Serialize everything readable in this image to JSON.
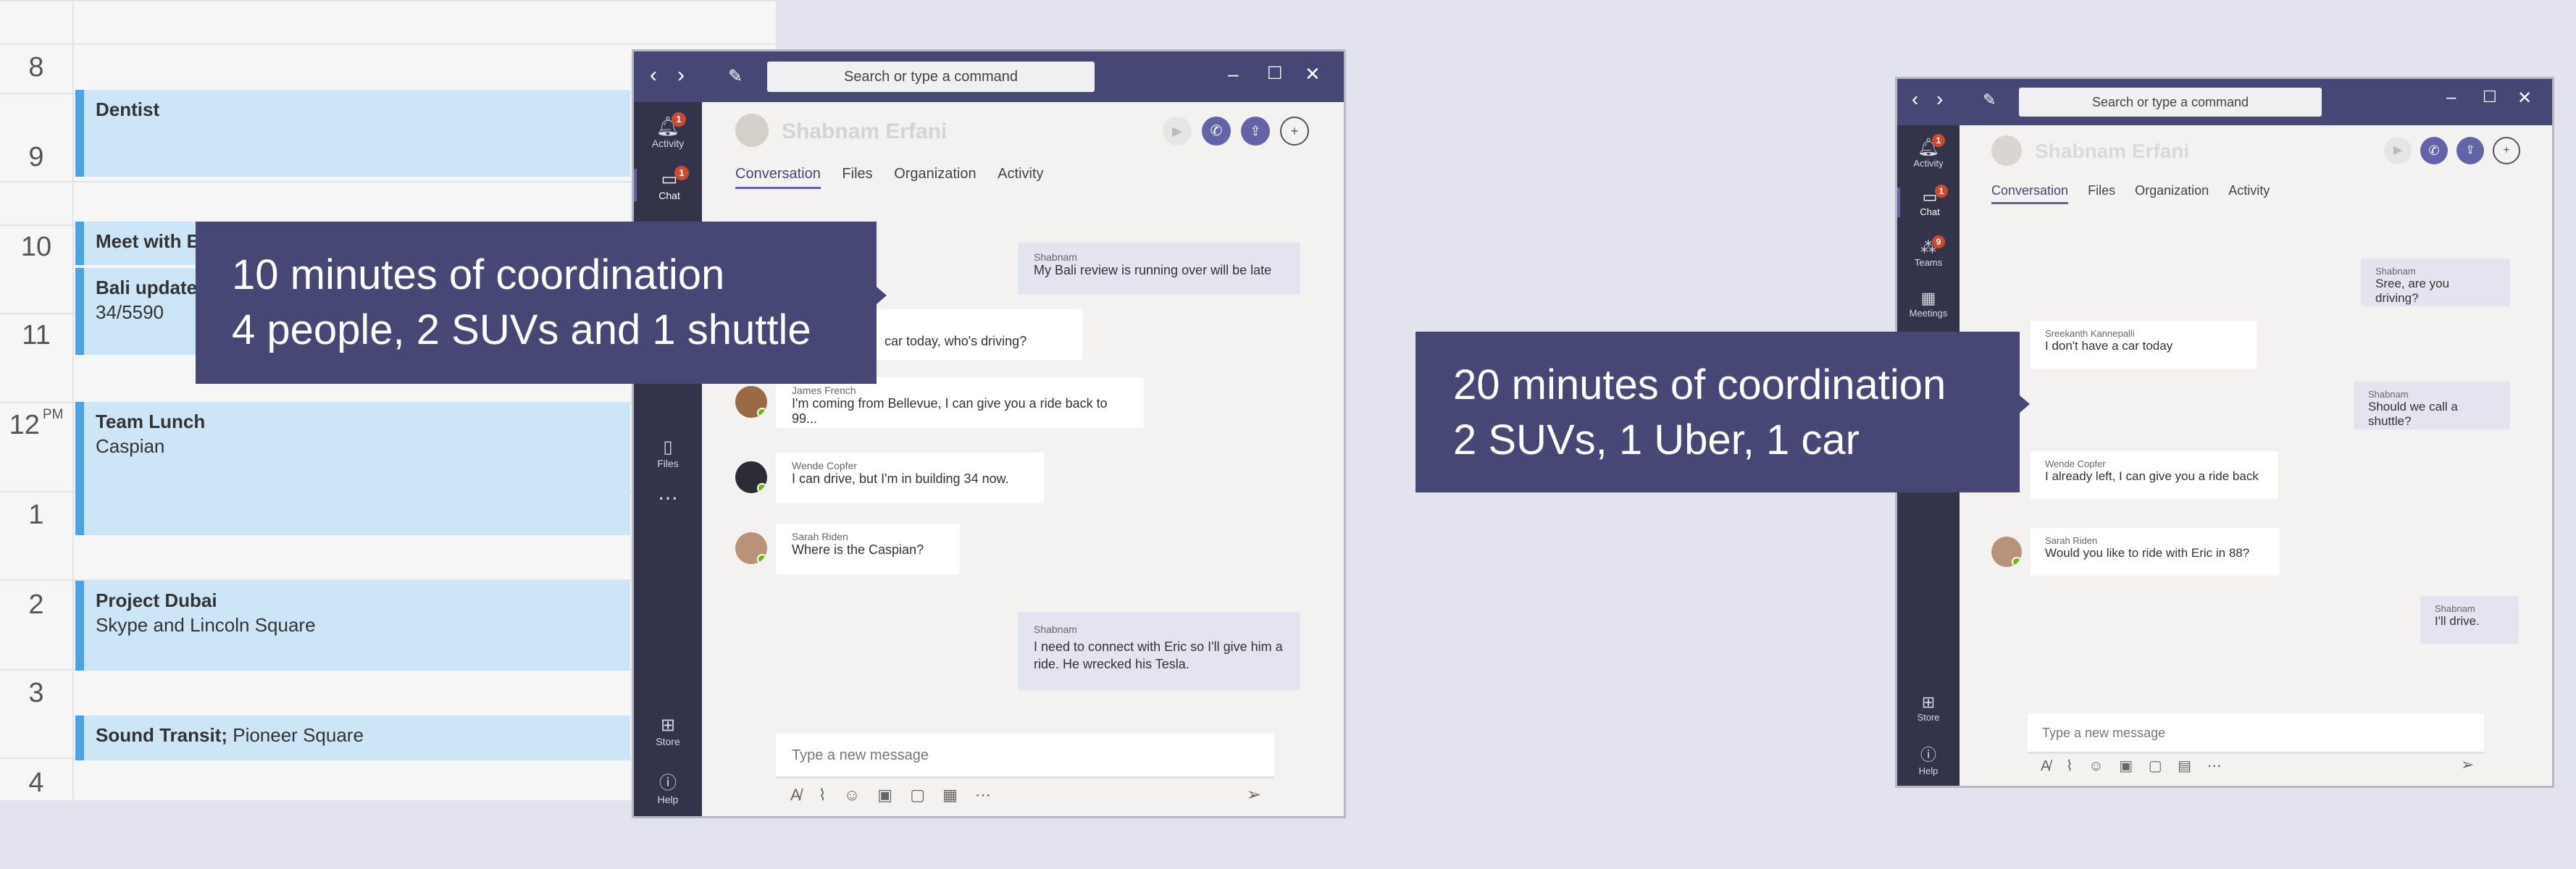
{
  "calendar": {
    "hours": [
      {
        "label": "8",
        "pm": ""
      },
      {
        "label": "9",
        "pm": ""
      },
      {
        "label": "10",
        "pm": ""
      },
      {
        "label": "11",
        "pm": ""
      },
      {
        "label": "12",
        "pm": "PM"
      },
      {
        "label": "1",
        "pm": ""
      },
      {
        "label": "2",
        "pm": ""
      },
      {
        "label": "3",
        "pm": ""
      },
      {
        "label": "4",
        "pm": ""
      }
    ],
    "events": [
      {
        "title": "Dentist",
        "detail": ""
      },
      {
        "title": "Meet with Er",
        "detail": ""
      },
      {
        "title": "Bali update",
        "detail": "34/5590"
      },
      {
        "title": "Team Lunch",
        "detail": "Caspian"
      },
      {
        "title": "Project Dubai",
        "detail": "Skype and Lincoln Square"
      },
      {
        "title": "Sound Transit;",
        "detail": " Pioneer Square"
      }
    ]
  },
  "window1": {
    "search_placeholder": "Search or type a command",
    "contact": "Shabnam Erfani",
    "tabs": [
      "Conversation",
      "Files",
      "Organization",
      "Activity"
    ],
    "rail": [
      {
        "label": "Activity",
        "badge": "1"
      },
      {
        "label": "Chat",
        "badge": "1"
      },
      {
        "label": "Files",
        "badge": ""
      },
      {
        "label": "Store",
        "badge": ""
      },
      {
        "label": "Help",
        "badge": ""
      }
    ],
    "messages": [
      {
        "sender": "Shabnam",
        "text": "My Bali review is running over will be late"
      },
      {
        "sender": "",
        "text": "car today, who's driving?"
      },
      {
        "sender": "James French",
        "text": "I'm coming from Bellevue, I can give you a ride back to 99..."
      },
      {
        "sender": "Wende Copfer",
        "text": "I can drive, but I'm in building 34 now."
      },
      {
        "sender": "Sarah Riden",
        "text": "Where is the Caspian?"
      },
      {
        "sender": "Shabnam",
        "text": "I need to connect with Eric so I'll give him a ride. He wrecked his Tesla."
      }
    ],
    "compose_placeholder": "Type a new message"
  },
  "window2": {
    "search_placeholder": "Search or type a command",
    "contact": "Shabnam Erfani",
    "tabs": [
      "Conversation",
      "Files",
      "Organization",
      "Activity"
    ],
    "rail": [
      {
        "label": "Activity",
        "badge": "1"
      },
      {
        "label": "Chat",
        "badge": "1"
      },
      {
        "label": "Teams",
        "badge": "9"
      },
      {
        "label": "Meetings",
        "badge": ""
      },
      {
        "label": "Store",
        "badge": ""
      },
      {
        "label": "Help",
        "badge": ""
      }
    ],
    "messages": [
      {
        "sender": "Shabnam",
        "text": "Sree, are you driving?"
      },
      {
        "sender": "Sreekanth Kannepalli",
        "text": "I don't have a car today"
      },
      {
        "sender": "Shabnam",
        "text": "Should we call a shuttle?"
      },
      {
        "sender": "Wende Copfer",
        "text": "I already left, I can give you a ride back"
      },
      {
        "sender": "Sarah Riden",
        "text": "Would you like to ride with Eric in 88?"
      },
      {
        "sender": "Shabnam",
        "text": "I'll drive."
      }
    ],
    "compose_placeholder": "Type a new message"
  },
  "callout1": {
    "line1": "10 minutes of coordination",
    "line2": "4 people, 2 SUVs and 1 shuttle"
  },
  "callout2": {
    "line1": "20 minutes of coordination",
    "line2": "2 SUVs, 1 Uber, 1 car"
  },
  "colors": {
    "teams_purple": "#464775",
    "rail_dark": "#33344a",
    "accent": "#6264a7",
    "event_fill": "#cde6f7",
    "event_bar": "#4aa3e6",
    "badge": "#cc4a31",
    "presence": "#6bb700"
  },
  "icons": [
    "back-arrow-icon",
    "forward-arrow-icon",
    "compose-icon",
    "minimize-icon",
    "maximize-icon",
    "close-icon",
    "bell-icon",
    "chat-icon",
    "teams-icon",
    "calendar-icon",
    "file-icon",
    "more-icon",
    "store-icon",
    "help-icon",
    "video-icon",
    "phone-icon",
    "screen-share-icon",
    "add-people-icon",
    "format-icon",
    "attach-icon",
    "emoji-icon",
    "gif-icon",
    "sticker-icon",
    "schedule-icon",
    "send-icon"
  ]
}
